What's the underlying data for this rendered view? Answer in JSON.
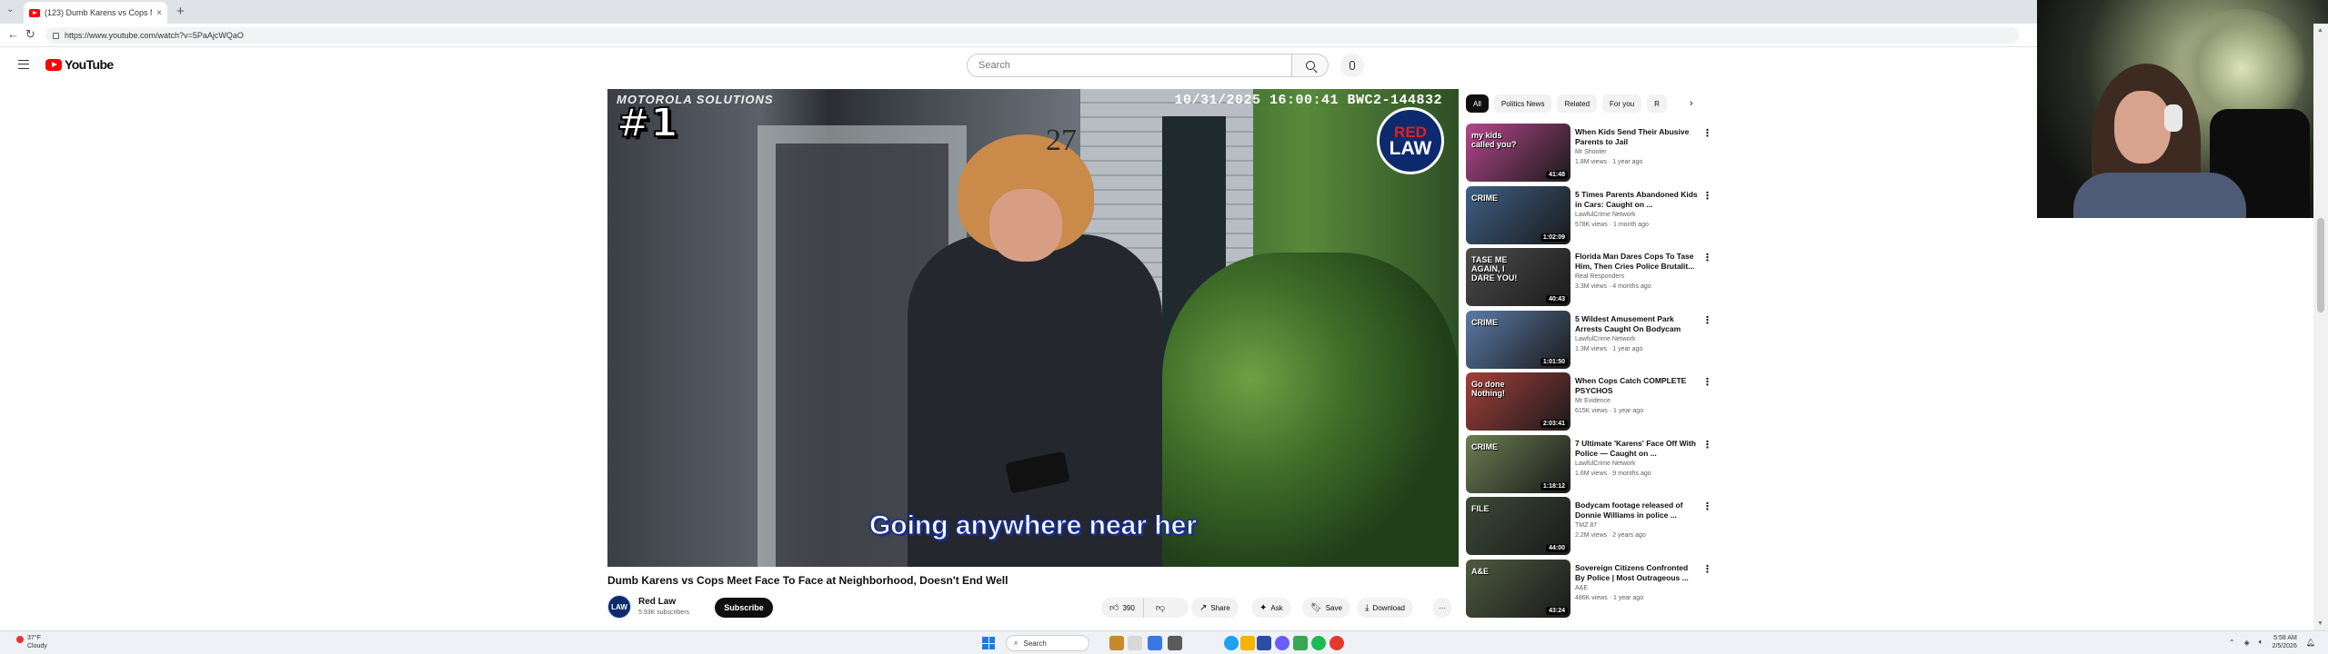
{
  "browser": {
    "tab_title": "(123) Dumb Karens vs Cops M",
    "tab_close": "×",
    "new_tab": "+",
    "url": "https://www.youtube.com/watch?v=5PaAjcWQaO"
  },
  "youtube": {
    "logo_text": "YouTube",
    "search_placeholder": "Search"
  },
  "player": {
    "cam_brand": "MOTOROLA SOLUTIONS",
    "cam_timestamp": "10/31/2025 16:00:41   BWC2-144832",
    "rank_badge": "#1",
    "house_number": "27",
    "channel_badge_line1": "RED",
    "channel_badge_line2": "LAW",
    "caption": "Going anywhere near her"
  },
  "video": {
    "title": "Dumb Karens vs Cops Meet Face To Face at Neighborhood, Doesn't End Well",
    "channel_name": "Red Law",
    "channel_avatar": "LAW",
    "subscribers": "5.93K subscribers",
    "subscribe_label": "Subscribe",
    "likes": "390",
    "share_label": "Share",
    "ask_label": "Ask",
    "save_label": "Save",
    "download_label": "Download",
    "more_label": "···"
  },
  "filters": {
    "chips": [
      "All",
      "Politics News",
      "Related",
      "For you",
      "R"
    ],
    "next": "›"
  },
  "recommendations": [
    {
      "title": "When Kids Send Their Abusive Parents to Jail",
      "channel": "Mr Shooter",
      "meta": "1.8M views · 1 year ago",
      "duration": "41:48",
      "thumb_text": "my kids called you?",
      "color": "#b3468c"
    },
    {
      "title": "5 Times Parents Abandoned Kids in Cars: Caught on ...",
      "channel": "LawfulCrime Network",
      "meta": "578K views · 1 month ago",
      "duration": "1:02:09",
      "thumb_text": "CRIME",
      "color": "#3f5f86"
    },
    {
      "title": "Florida Man Dares Cops To Tase Him, Then Cries Police Brutalit...",
      "channel": "Real Responders",
      "meta": "3.3M views · 4 months ago",
      "duration": "40:43",
      "thumb_text": "TASE ME AGAIN, I DARE YOU!",
      "color": "#4c4c4c"
    },
    {
      "title": "5 Wildest Amusement Park Arrests Caught On Bodycam",
      "channel": "LawfulCrime Network",
      "meta": "1.3M views · 1 year ago",
      "duration": "1:01:50",
      "thumb_text": "CRIME",
      "color": "#5b7aa6"
    },
    {
      "title": "When Cops Catch COMPLETE PSYCHOS",
      "channel": "Mr Evidence",
      "meta": "615K views · 1 year ago",
      "duration": "2:03:41",
      "thumb_text": "Go done Nothing!",
      "color": "#a33f3a"
    },
    {
      "title": "7 Ultimate 'Karens' Face Off With Police — Caught on ...",
      "channel": "LawfulCrime Network",
      "meta": "1.6M views · 9 months ago",
      "duration": "1:18:12",
      "thumb_text": "CRIME",
      "color": "#6a7d52"
    },
    {
      "title": "Bodycam footage released of Donnie Williams in police ...",
      "channel": "TMZ 87",
      "meta": "2.2M views · 2 years ago",
      "duration": "44:00",
      "thumb_text": "FILE",
      "color": "#3b4a37"
    },
    {
      "title": "Sovereign Citizens Confronted By Police | Most Outrageous ...",
      "channel": "A&E",
      "meta": "486K views · 1 year ago",
      "duration": "43:24",
      "thumb_text": "A&E",
      "color": "#4d5a3f"
    }
  ],
  "taskbar": {
    "weather_temp": "37°F",
    "weather_desc": "Cloudy",
    "search_label": "Search",
    "time": "5:58 AM",
    "date": "2/5/2026"
  },
  "colors": {
    "youtube_red": "#ff0000",
    "subscribe_bg": "#0f0f0f",
    "caption_outline": "#1a2f8a"
  }
}
